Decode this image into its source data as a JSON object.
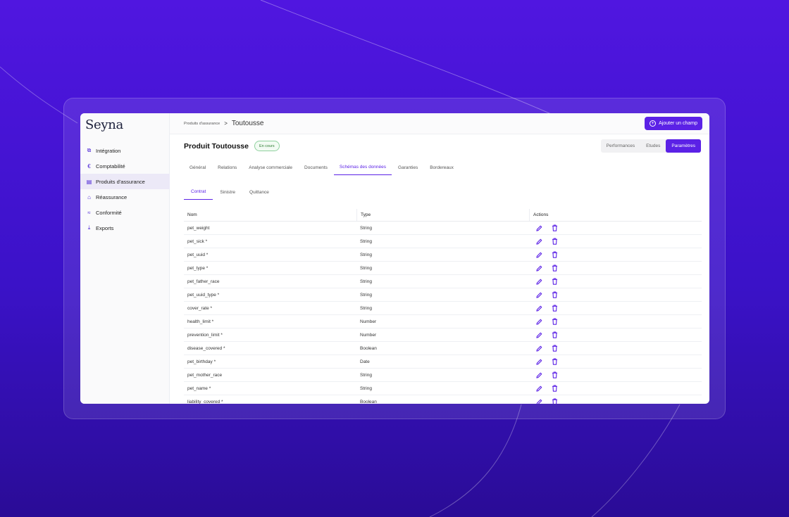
{
  "app": {
    "logo": "Seyna"
  },
  "sidebar": {
    "items": [
      {
        "label": "Intégration",
        "icon": "integration-icon"
      },
      {
        "label": "Comptabilité",
        "icon": "euro-icon"
      },
      {
        "label": "Produits d'assurance",
        "icon": "calendar-icon"
      },
      {
        "label": "Réassurance",
        "icon": "bank-icon"
      },
      {
        "label": "Conformité",
        "icon": "compliance-icon"
      },
      {
        "label": "Exports",
        "icon": "download-icon"
      }
    ],
    "active_index": 2
  },
  "header": {
    "breadcrumb_parent": "Produits d'assurance",
    "breadcrumb_sep": ">",
    "breadcrumb_current": "Toutousse",
    "add_button": "Ajouter un champ"
  },
  "product": {
    "title": "Produit Toutousse",
    "status": "En cours"
  },
  "view_switch": {
    "options": [
      "Performances",
      "Etudes",
      "Paramètres"
    ],
    "active": "Paramètres"
  },
  "tabs": {
    "items": [
      "Général",
      "Relations",
      "Analyse commerciale",
      "Documents",
      "Schémas des données",
      "Garanties",
      "Bordereaux"
    ],
    "active": "Schémas des données"
  },
  "subtabs": {
    "items": [
      "Contrat",
      "Sinistre",
      "Quittance"
    ],
    "active": "Contrat"
  },
  "table": {
    "columns": [
      "Nom",
      "Type",
      "Actions"
    ],
    "rows": [
      {
        "nom": "pet_weight",
        "type": "String"
      },
      {
        "nom": "pet_sick *",
        "type": "String"
      },
      {
        "nom": "pet_uuid *",
        "type": "String"
      },
      {
        "nom": "pet_type *",
        "type": "String"
      },
      {
        "nom": "pet_father_race",
        "type": "String"
      },
      {
        "nom": "pet_uuid_type *",
        "type": "String"
      },
      {
        "nom": "cover_rate *",
        "type": "String"
      },
      {
        "nom": "health_limit *",
        "type": "Number"
      },
      {
        "nom": "prevention_limit *",
        "type": "Number"
      },
      {
        "nom": "disease_covered *",
        "type": "Boolean"
      },
      {
        "nom": "pet_birthday *",
        "type": "Date"
      },
      {
        "nom": "pet_mother_race",
        "type": "String"
      },
      {
        "nom": "pet_name *",
        "type": "String"
      },
      {
        "nom": "liability_covered *",
        "type": "Boolean"
      }
    ]
  },
  "colors": {
    "accent": "#5b21e6",
    "background": "#4a14dc",
    "status_green": "#2e7d32"
  }
}
